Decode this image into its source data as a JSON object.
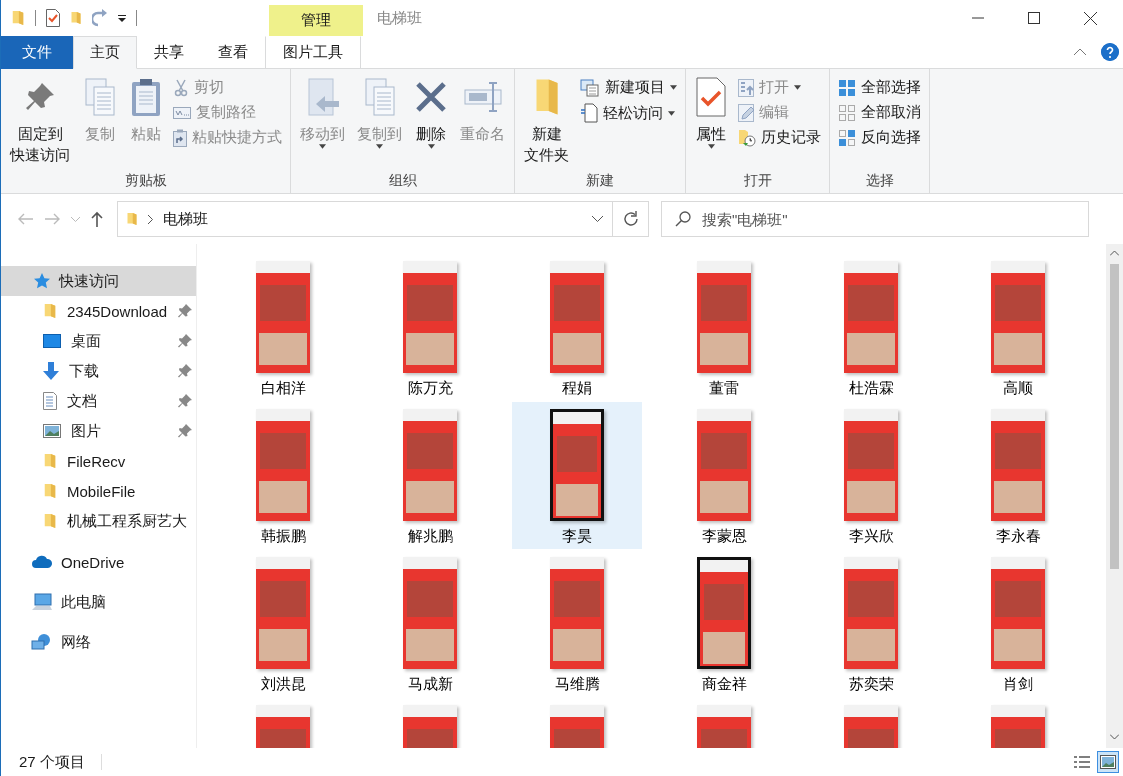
{
  "window": {
    "title": "电梯班",
    "context_header": "管理"
  },
  "ribbon_tabs": [
    {
      "label": "文件",
      "kind": "file",
      "selected": false
    },
    {
      "label": "主页",
      "kind": "tab",
      "selected": true
    },
    {
      "label": "共享",
      "kind": "tab",
      "selected": false
    },
    {
      "label": "查看",
      "kind": "tab",
      "selected": false
    },
    {
      "label": "图片工具",
      "kind": "context",
      "selected": false
    }
  ],
  "ribbon_groups": [
    {
      "label": "剪贴板",
      "columns": [
        {
          "kind": "large",
          "items": [
            {
              "lines": [
                "固定到",
                "快速访问"
              ],
              "disabled": false,
              "dropdown": false
            }
          ]
        },
        {
          "kind": "large",
          "items": [
            {
              "lines": [
                "复制"
              ],
              "disabled": true,
              "dropdown": false
            }
          ]
        },
        {
          "kind": "large",
          "items": [
            {
              "lines": [
                "粘贴"
              ],
              "disabled": true,
              "dropdown": false
            }
          ]
        },
        {
          "kind": "small",
          "items": [
            {
              "lines": [
                "剪切"
              ],
              "disabled": true,
              "dropdown": false
            },
            {
              "lines": [
                "复制路径"
              ],
              "disabled": true,
              "dropdown": false
            },
            {
              "lines": [
                "粘贴快捷方式"
              ],
              "disabled": true,
              "dropdown": false
            }
          ]
        }
      ]
    },
    {
      "label": "组织",
      "columns": [
        {
          "kind": "large",
          "items": [
            {
              "lines": [
                "移动到"
              ],
              "disabled": true,
              "dropdown": true
            }
          ]
        },
        {
          "kind": "large",
          "items": [
            {
              "lines": [
                "复制到"
              ],
              "disabled": true,
              "dropdown": true
            }
          ]
        },
        {
          "kind": "large",
          "items": [
            {
              "lines": [
                "删除"
              ],
              "disabled": false,
              "dropdown": true
            }
          ]
        },
        {
          "kind": "large",
          "items": [
            {
              "lines": [
                "重命名"
              ],
              "disabled": true,
              "dropdown": false
            }
          ]
        }
      ]
    },
    {
      "label": "新建",
      "columns": [
        {
          "kind": "large",
          "items": [
            {
              "lines": [
                "新建",
                "文件夹"
              ],
              "disabled": false,
              "dropdown": false
            }
          ]
        },
        {
          "kind": "small",
          "items": [
            {
              "lines": [
                "新建项目"
              ],
              "disabled": false,
              "dropdown": true
            },
            {
              "lines": [
                "轻松访问"
              ],
              "disabled": false,
              "dropdown": true
            }
          ]
        }
      ]
    },
    {
      "label": "打开",
      "columns": [
        {
          "kind": "large",
          "items": [
            {
              "lines": [
                "属性"
              ],
              "disabled": false,
              "dropdown": true
            }
          ]
        },
        {
          "kind": "small",
          "items": [
            {
              "lines": [
                "打开"
              ],
              "disabled": true,
              "dropdown": true
            },
            {
              "lines": [
                "编辑"
              ],
              "disabled": true,
              "dropdown": false
            },
            {
              "lines": [
                "历史记录"
              ],
              "disabled": false,
              "dropdown": false
            }
          ]
        }
      ]
    },
    {
      "label": "选择",
      "columns": [
        {
          "kind": "small",
          "items": [
            {
              "lines": [
                "全部选择"
              ],
              "disabled": false,
              "dropdown": false
            },
            {
              "lines": [
                "全部取消"
              ],
              "disabled": false,
              "dropdown": false
            },
            {
              "lines": [
                "反向选择"
              ],
              "disabled": false,
              "dropdown": false
            }
          ]
        }
      ]
    }
  ],
  "address": {
    "path": [
      "电梯班"
    ]
  },
  "search": {
    "placeholder": "搜索\"电梯班\""
  },
  "nav": [
    {
      "label": "快速访问",
      "selected": true,
      "children": [
        {
          "label": "2345Download",
          "pinned": true
        },
        {
          "label": "桌面",
          "pinned": true
        },
        {
          "label": "下载",
          "pinned": true
        },
        {
          "label": "文档",
          "pinned": true
        },
        {
          "label": "图片",
          "pinned": true
        },
        {
          "label": "FileRecv",
          "pinned": false
        },
        {
          "label": "MobileFile",
          "pinned": false
        },
        {
          "label": "机械工程系厨艺大",
          "pinned": false
        }
      ]
    },
    {
      "label": "OneDrive",
      "selected": false
    },
    {
      "label": "此电脑",
      "selected": false
    },
    {
      "label": "网络",
      "selected": false
    }
  ],
  "files": [
    {
      "name": "白相洋",
      "kind": "screenshot",
      "selected": false
    },
    {
      "name": "陈万充",
      "kind": "screenshot",
      "selected": false
    },
    {
      "name": "程娟",
      "kind": "screenshot",
      "selected": false
    },
    {
      "name": "董雷",
      "kind": "screenshot",
      "selected": false
    },
    {
      "name": "杜浩霖",
      "kind": "screenshot",
      "selected": false
    },
    {
      "name": "高顺",
      "kind": "screenshot",
      "selected": false
    },
    {
      "name": "韩振鹏",
      "kind": "screenshot",
      "selected": false
    },
    {
      "name": "解兆鹏",
      "kind": "screenshot",
      "selected": false
    },
    {
      "name": "李昊",
      "kind": "framed",
      "selected": true
    },
    {
      "name": "李蒙恩",
      "kind": "screenshot",
      "selected": false
    },
    {
      "name": "李兴欣",
      "kind": "screenshot",
      "selected": false
    },
    {
      "name": "李永春",
      "kind": "screenshot",
      "selected": false
    },
    {
      "name": "刘洪昆",
      "kind": "screenshot",
      "selected": false
    },
    {
      "name": "马成新",
      "kind": "screenshot",
      "selected": false
    },
    {
      "name": "马维腾",
      "kind": "screenshot",
      "selected": false
    },
    {
      "name": "商金祥",
      "kind": "framed",
      "selected": false
    },
    {
      "name": "苏奕荣",
      "kind": "screenshot",
      "selected": false
    },
    {
      "name": "肖剑",
      "kind": "screenshot",
      "selected": false
    },
    {
      "kind": "screenshot",
      "selected": false
    },
    {
      "kind": "screenshot",
      "selected": false
    },
    {
      "kind": "screenshot",
      "selected": false
    },
    {
      "kind": "screenshot",
      "selected": false
    },
    {
      "kind": "screenshot",
      "selected": false
    },
    {
      "kind": "screenshot",
      "selected": false
    }
  ],
  "status_bar": {
    "item_count": "27 个项目"
  },
  "view_buttons": [
    {
      "kind": "details",
      "selected": false
    },
    {
      "kind": "large_icons",
      "selected": true
    }
  ]
}
